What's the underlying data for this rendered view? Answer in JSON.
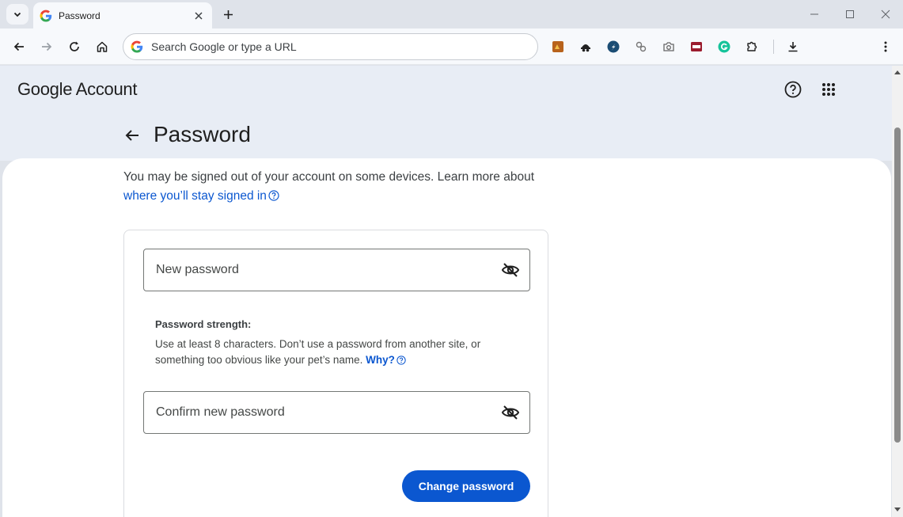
{
  "browser": {
    "tab_title": "Password",
    "omnibox_placeholder": "Search Google or type a URL",
    "icons": {
      "tab_search": "chevron-down-icon",
      "favicon": "google-g-icon",
      "close": "close-icon",
      "new_tab": "plus-icon",
      "back": "arrow-left-icon",
      "forward": "arrow-right-icon",
      "reload": "reload-icon",
      "home": "home-icon",
      "extensions": "puzzle-icon",
      "downloads": "download-icon",
      "menu": "kebab-menu-icon"
    },
    "extensions": [
      "ext-1-icon",
      "ext-2-icon",
      "ext-3-icon",
      "ext-4-icon",
      "camera-icon",
      "ext-6-icon",
      "grammarly-icon"
    ]
  },
  "header": {
    "brand_google": "Google",
    "brand_account": "Account"
  },
  "page": {
    "title": "Password",
    "notice_text": "You may be signed out of your account on some devices. Learn more about",
    "notice_link": "where you’ll stay signed in",
    "new_password_label": "New password",
    "strength_title": "Password strength:",
    "strength_text": "Use at least 8 characters. Don’t use a password from another site, or something too obvious like your pet’s name.",
    "why_link": "Why?",
    "confirm_password_label": "Confirm new password",
    "change_button": "Change password"
  },
  "colors": {
    "accent": "#0b57d0",
    "header_bg": "#e8edf5",
    "chrome_bg": "#dfe3ea"
  }
}
